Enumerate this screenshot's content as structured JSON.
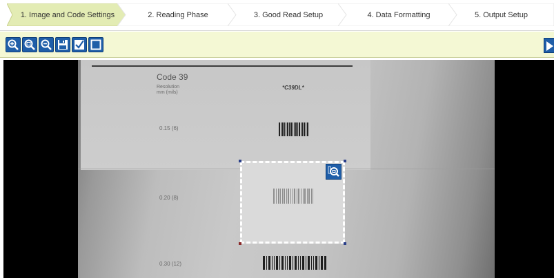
{
  "wizard": {
    "steps": [
      {
        "label": "1. Image and Code Settings",
        "active": true
      },
      {
        "label": "2. Reading Phase",
        "active": false
      },
      {
        "label": "3. Good Read Setup",
        "active": false
      },
      {
        "label": "4. Data Formatting",
        "active": false
      },
      {
        "label": "5. Output Setup",
        "active": false
      }
    ],
    "active_color": "#e3ecb4",
    "inactive_color": "#ffffff"
  },
  "toolbar": {
    "buttons": [
      {
        "icon": "zoom-in-icon"
      },
      {
        "icon": "zoom-fit-icon"
      },
      {
        "icon": "zoom-out-icon"
      },
      {
        "icon": "save-image-icon"
      },
      {
        "icon": "checkmark-icon"
      },
      {
        "icon": "select-window-icon"
      }
    ],
    "play_icon": "play-icon",
    "background": "#f4f8d4",
    "button_color": "#1f5ea8"
  },
  "viewer": {
    "sheet": {
      "title": "Code 39",
      "resolution_label_1": "Resolution",
      "resolution_label_2": "mm (mils)",
      "code_sample": "*C39DL*",
      "rows": [
        {
          "label": "0.15 (6)"
        },
        {
          "label": "0.20 (8)"
        },
        {
          "label": "0.30 (12)"
        }
      ]
    },
    "roi_zoom_icon": "zoom-roi-icon"
  }
}
